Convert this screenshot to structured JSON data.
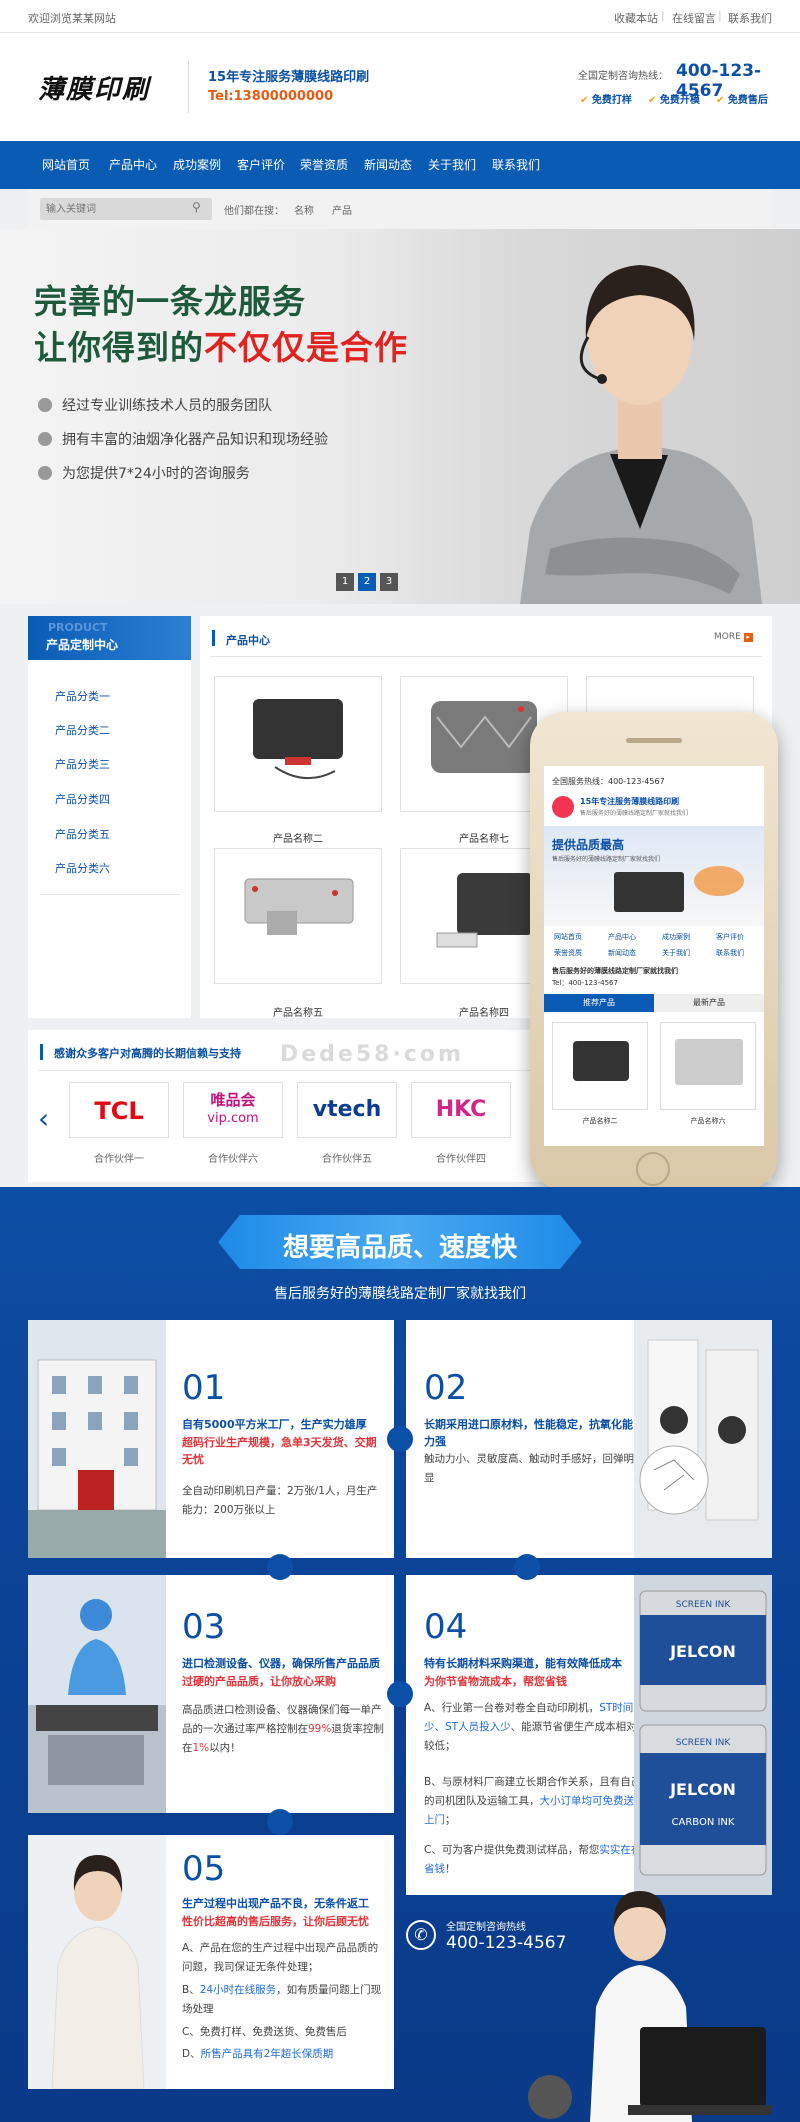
{
  "topbar": {
    "welcome": "欢迎浏览某某网站",
    "links": [
      "收藏本站",
      "在线留言",
      "联系我们"
    ]
  },
  "header": {
    "logo": "薄膜印刷",
    "slogan": "15年专注服务薄膜线路印刷",
    "tel": "Tel:13800000000",
    "hotline_label": "全国定制咨询热线：",
    "hotline": "400-123-4567",
    "badges": [
      "免费打样",
      "免费开模",
      "免费售后"
    ]
  },
  "nav": [
    "网站首页",
    "产品中心",
    "成功案例",
    "客户评价",
    "荣誉资质",
    "新闻动态",
    "关于我们",
    "联系我们"
  ],
  "search": {
    "placeholder": "输入关键词",
    "label": "他们都在搜：",
    "terms": [
      "名称",
      "产品"
    ]
  },
  "banner": {
    "line1": "完善的一条龙服务",
    "line2a": "让你得到的",
    "line2b": "不仅仅是合作",
    "bullets": [
      "经过专业训练技术人员的服务团队",
      "拥有丰富的油烟净化器产品知识和现场经验",
      "为您提供7*24小时的咨询服务"
    ],
    "pages": [
      "1",
      "2",
      "3"
    ]
  },
  "sidebar": {
    "en": "PRODUCT",
    "title": "产品定制中心",
    "items": [
      "产品分类一",
      "产品分类二",
      "产品分类三",
      "产品分类四",
      "产品分类五",
      "产品分类六"
    ]
  },
  "products": {
    "title": "产品中心",
    "more": "MORE",
    "items": [
      "产品名称二",
      "产品名称七",
      "产品名称五",
      "产品名称四"
    ]
  },
  "partners": {
    "title": "感谢众多客户对高腾的长期信赖与支持",
    "logos": [
      "TCL",
      "唯品会",
      "vip.com",
      "vtech",
      "HKC"
    ],
    "names": [
      "合作伙伴一",
      "合作伙伴六",
      "合作伙伴五",
      "合作伙伴四"
    ]
  },
  "watermark": "Dede58·com",
  "phone": {
    "hotline": "全国服务热线：400-123-4567",
    "slogan": "15年专注服务薄膜线路印刷",
    "sub": "售后服务好的薄膜线路定制厂家就找我们",
    "banner_big": "提供品质最高",
    "banner_small": "售后服务好的薄膜线路定制厂家就找我们",
    "nav": [
      "网站首页",
      "产品中心",
      "成功案例",
      "客户评价",
      "荣誉资质",
      "新闻动态",
      "关于我们",
      "联系我们"
    ],
    "company": "售后服务好的薄膜线路定制厂家就找我们",
    "tel": "Tel：400-123-4567",
    "tabs": [
      "推荐产品",
      "最新产品"
    ],
    "products": [
      "产品名称二",
      "产品名称六"
    ]
  },
  "features": {
    "title": "想要高品质、速度快",
    "subtitle": "售后服务好的薄膜线路定制厂家就找我们",
    "items": [
      {
        "num": "01",
        "t1": "自有5000平方米工厂，生产实力雄厚",
        "t2": "超码行业生产规模，急单3天发货、交期无忧",
        "body": "全自动印刷机日产量：2万张/1人，月生产能力：200万张以上"
      },
      {
        "num": "02",
        "t1": "长期采用进口原材料，性能稳定，抗氧化能力强",
        "t2": "",
        "body": "触动力小、灵敏度高、触动时手感好，回弹明显"
      },
      {
        "num": "03",
        "t1": "进口检测设备、仪器，确保所售产品品质",
        "t2": "过硬的产品品质，让你放心采购",
        "body_a": "高品质进口检测设备、仪器确保们每一单产品的一次通过率严格控制在",
        "body_b": "99%",
        "body_c": "退货率控制在",
        "body_d": "1%",
        "body_e": "以内！"
      },
      {
        "num": "04",
        "t1": "特有长期材料采购渠道，能有效降低成本",
        "t2": "为你节省物流成本，帮您省钱",
        "a1": "A、行业第一台卷对卷全自动印刷机，",
        "a2": "ST时间减少、ST人员投入少",
        "a3": "、能源节省便生产成本相对较低；",
        "b1": "B、与原材料厂商建立长期合作关系，且有自己的司机团队及运输工具，",
        "b2": "大小订单均可免费送货上门",
        "b3": "；",
        "c1": "C、可为客户提供免费测试样品，帮您",
        "c2": "实实在在省钱",
        "c3": "！"
      },
      {
        "num": "05",
        "t1": "生产过程中出现产品不良，无条件返工",
        "t2": "性价比超高的售后服务，让你后顾无忧",
        "a": "A、产品在您的生产过程中出现产品品质的问题，我司保证无条件处理；",
        "b1": "B、",
        "b2": "24小时在线服务",
        "b3": "，如有质量问题上门现场处理",
        "c": "C、免费打样、免费送货、免费售后",
        "d1": "D、",
        "d2": "所售产品具有2年超长保质期"
      }
    ],
    "hotline_label": "全国定制咨询热线",
    "hotline": "400-123-4567",
    "cans": [
      "SCREEN INK",
      "JELCON",
      "CARBON INK"
    ]
  }
}
